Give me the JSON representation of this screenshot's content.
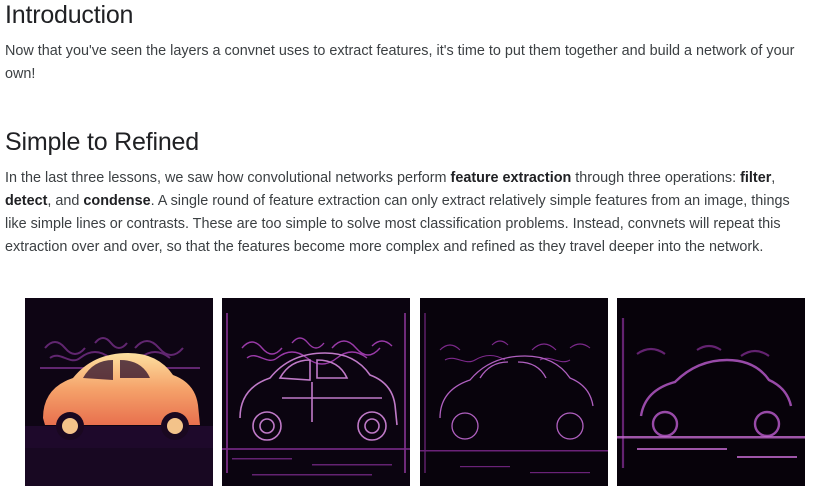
{
  "intro": {
    "title": "Introduction",
    "paragraph": "Now that you've seen the layers a convnet uses to extract features, it's time to put them together and build a network of your own!"
  },
  "section": {
    "title": "Simple to Refined",
    "paragraph": {
      "t1": "In the last three lessons, we saw how convolutional networks perform ",
      "b1": "feature extraction",
      "t2": " through three operations: ",
      "b2": "filter",
      "t3": ", ",
      "b3": "detect",
      "t4": ", and ",
      "b4": "condense",
      "t5": ". A single round of feature extraction can only extract relatively simple features from an image, things like simple lines or contrasts. These are too simple to solve most classification problems. Instead, convnets will repeat this extraction over and over, so that the features become more complex and refined as they travel deeper into the network."
    }
  },
  "images": [
    {
      "name": "feature-map-original",
      "style": "heat"
    },
    {
      "name": "feature-map-edges",
      "style": "edges"
    },
    {
      "name": "feature-map-sparse",
      "style": "sparse"
    },
    {
      "name": "feature-map-refined",
      "style": "refined"
    }
  ]
}
